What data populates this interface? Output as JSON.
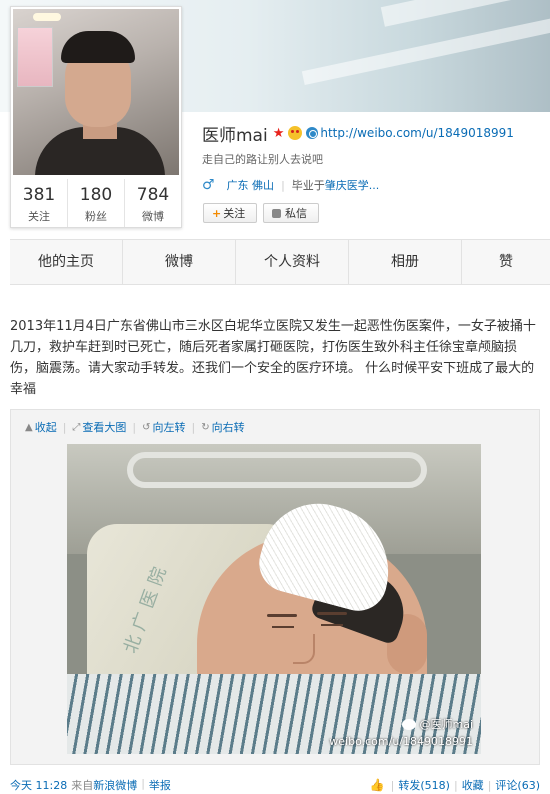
{
  "profile": {
    "name": "医师mai",
    "url": "http://weibo.com/u/1849018991",
    "bio": "走自己的路让别人去说吧",
    "gender_icon": "male-icon",
    "location": "广东 佛山",
    "school_prefix": "毕业于",
    "school": "肇庆医学...",
    "stats": [
      {
        "num": "381",
        "label": "关注"
      },
      {
        "num": "180",
        "label": "粉丝"
      },
      {
        "num": "784",
        "label": "微博"
      }
    ],
    "follow_label": "关注",
    "message_label": "私信"
  },
  "tabs": [
    "他的主页",
    "微博",
    "个人资料",
    "相册",
    "赞"
  ],
  "post": {
    "text": "2013年11月4日广东省佛山市三水区白坭华立医院又发生一起恶性伤医案件，一女子被捅十几刀，救护车赶到时已死亡，随后死者家属打砸医院，打伤医生致外科主任徐宝章颅脑损伤，脑震荡。请大家动手转发。还我们一个安全的医疗环境。 什么时候平安下班成了最大的幸福",
    "media_tools": {
      "collapse": "收起",
      "view_large": "查看大图",
      "rotate_left": "向左转",
      "rotate_right": "向右转"
    },
    "watermark_name": "@医师mai",
    "watermark_url": "weibo.com/u/1849018991",
    "pillow_text": "北广医院"
  },
  "footer": {
    "time": "今天 11:28",
    "source_prefix": "来自",
    "source": "新浪微博",
    "report": "举报",
    "repost": "转发(518)",
    "favorite": "收藏",
    "comment": "评论(63)"
  },
  "colors": {
    "link": "#0a6cb5",
    "star": "#e8221c",
    "follow_plus": "#f28a00"
  }
}
